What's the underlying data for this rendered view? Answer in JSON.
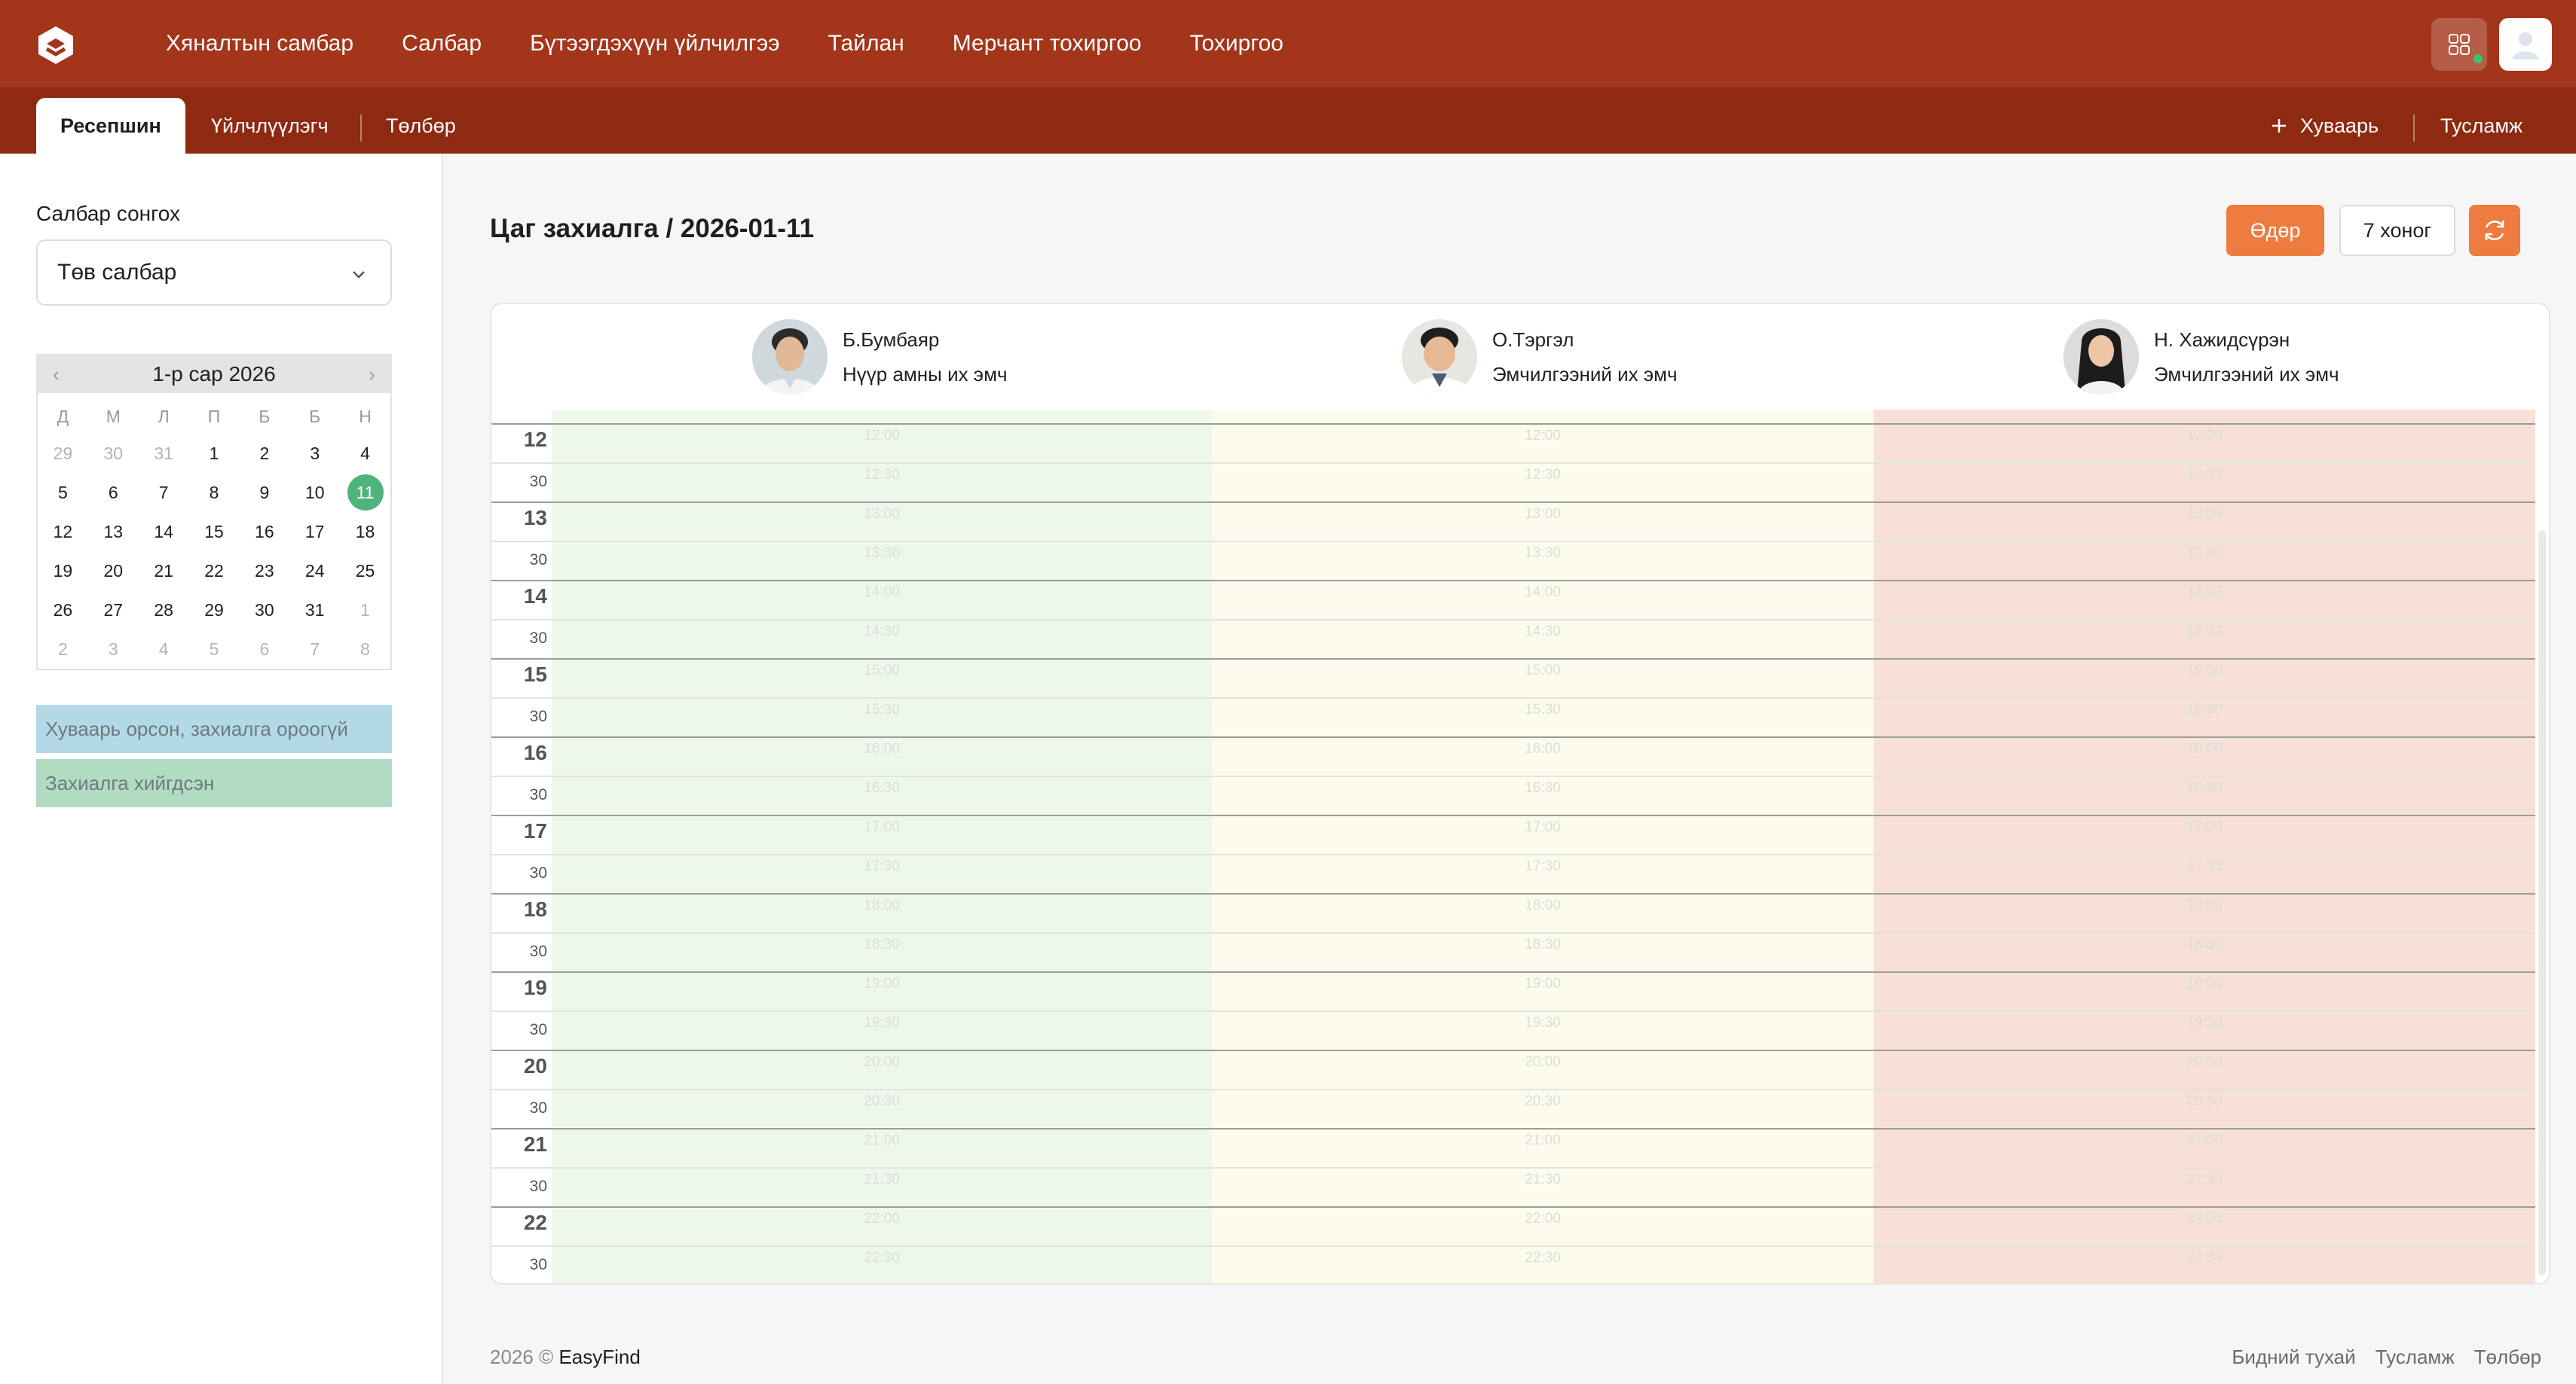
{
  "topnav": {
    "items": [
      "Хяналтын самбар",
      "Салбар",
      "Бүтээгдэхүүн үйлчилгээ",
      "Тайлан",
      "Мерчант тохиргоо",
      "Тохиргоо"
    ]
  },
  "subnav": {
    "tabs": [
      "Ресепшин",
      "Үйлчлүүлэгч",
      "Төлбөр"
    ],
    "active": "Ресепшин",
    "schedule_label": "Хуваарь",
    "help_label": "Тусламж"
  },
  "sidebar": {
    "branch_label": "Салбар сонгох",
    "branch_value": "Төв салбар",
    "calendar": {
      "month_label": "1-р сар 2026",
      "weekdays": [
        "Д",
        "М",
        "Л",
        "П",
        "Б",
        "Б",
        "Н"
      ],
      "days": [
        "29",
        "30",
        "31",
        "1",
        "2",
        "3",
        "4",
        "5",
        "6",
        "7",
        "8",
        "9",
        "10",
        "11",
        "12",
        "13",
        "14",
        "15",
        "16",
        "17",
        "18",
        "19",
        "20",
        "21",
        "22",
        "23",
        "24",
        "25",
        "26",
        "27",
        "28",
        "29",
        "30",
        "31",
        "1",
        "2",
        "3",
        "4",
        "5",
        "6",
        "7",
        "8"
      ],
      "selected": "11"
    },
    "legend": {
      "scheduled_free": "Хуваарь орсон, захиалга ороогүй",
      "booked": "Захиалга хийгдсэн"
    }
  },
  "main": {
    "title": "Цаг захиалга / 2026-01-11",
    "view_day": "Өдөр",
    "view_week": "7 хоног",
    "doctors": [
      {
        "name": "Б.Бумбаяр",
        "role": "Нүүр амны их эмч"
      },
      {
        "name": "О.Тэргэл",
        "role": "Эмчилгээний их эмч"
      },
      {
        "name": "Н. Хажидсүрэн",
        "role": "Эмчилгээний их эмч"
      }
    ],
    "hours": [
      "12",
      "13",
      "14",
      "15",
      "16",
      "17",
      "18",
      "19",
      "20",
      "21",
      "22"
    ],
    "half_label": "30",
    "slots": [
      "12:00",
      "12:30",
      "13:00",
      "13:30",
      "14:00",
      "14:30",
      "15:00",
      "15:30",
      "16:00",
      "16:30",
      "17:00",
      "17:30",
      "18:00",
      "18:30",
      "19:00",
      "19:30",
      "20:00",
      "20:30",
      "21:00",
      "21:30",
      "22:00",
      "22:30"
    ]
  },
  "footer": {
    "year": "2026 ©",
    "brand": "EasyFind",
    "links": [
      "Бидний тухай",
      "Тусламж",
      "Төлбөр"
    ]
  },
  "colors": {
    "topbar": "#a3351b",
    "subbar": "#8e2a12",
    "accent": "#ee7b3f",
    "selected_day": "#4fb37c",
    "legend_free": "#b4d9e6",
    "legend_booked": "#b2dcc2",
    "col_green": "#eef8ea",
    "col_yellow": "#fdfbec",
    "col_red": "#f7e0d5"
  },
  "icons": {
    "logo": "easyfind-logo-icon",
    "apps": "grid-apps-icon",
    "user": "user-avatar-icon",
    "plus": "plus-icon",
    "chevron": "chevron-down-icon",
    "refresh": "refresh-icon"
  }
}
